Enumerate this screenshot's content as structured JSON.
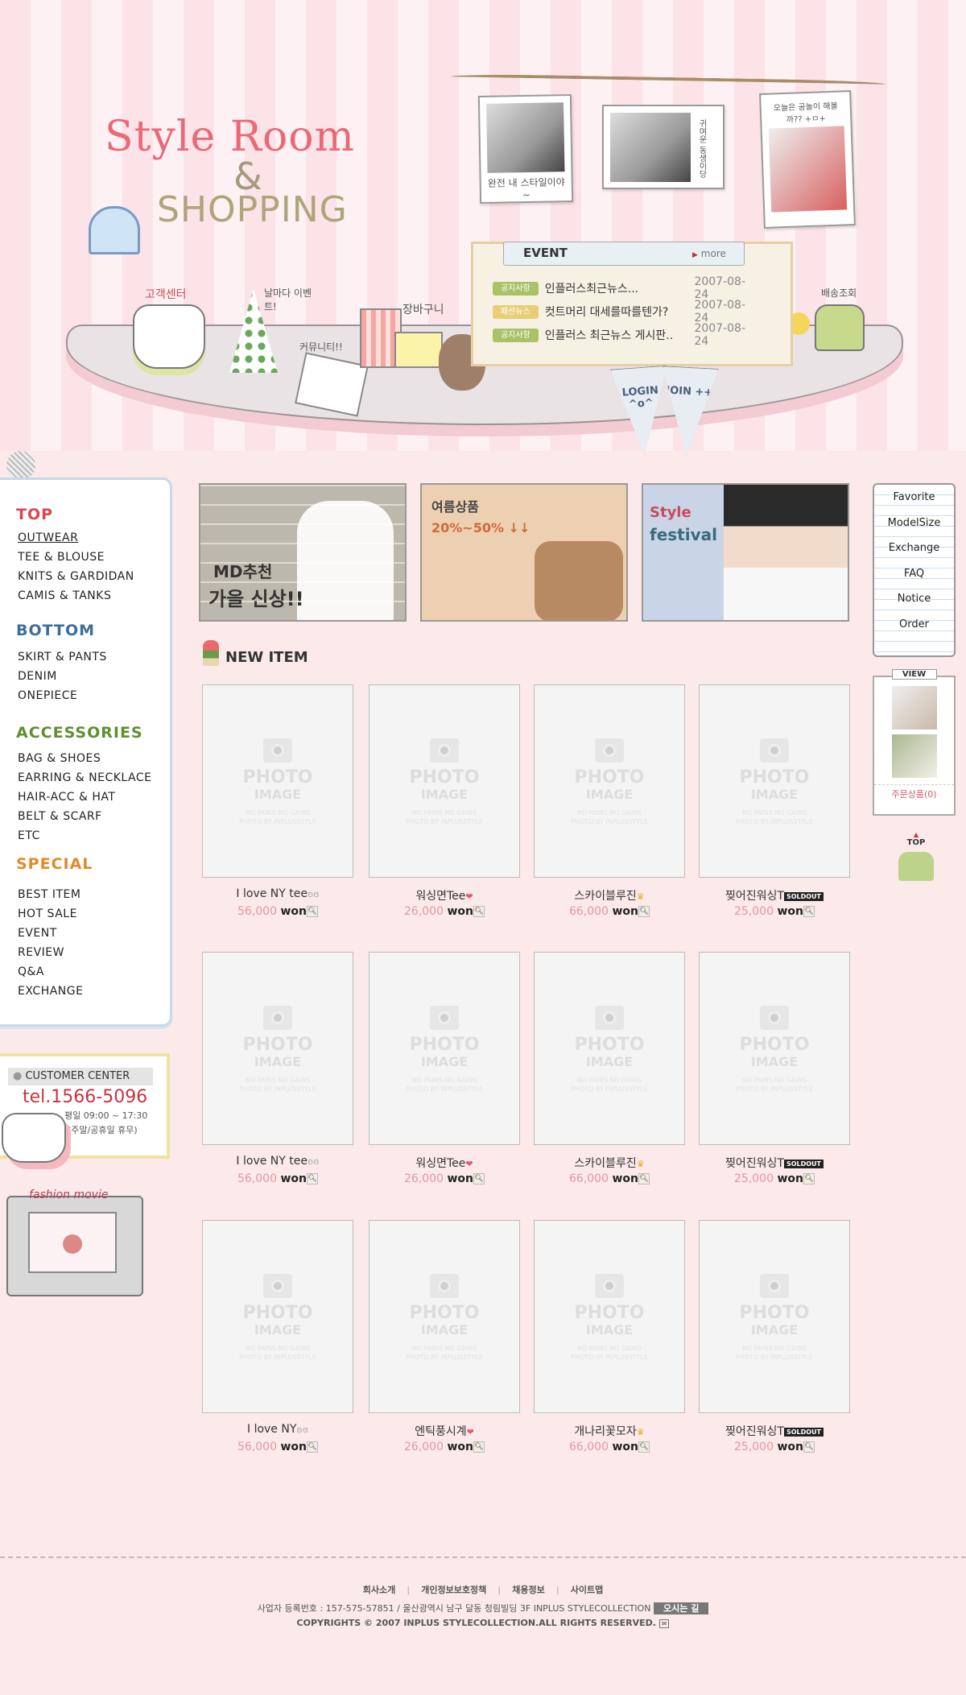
{
  "logo": {
    "line1": "Style Room",
    "amp": "&",
    "line2": "SHOPPING"
  },
  "hanging_photos": [
    {
      "caption": "완전 내 스타일이야~"
    },
    {
      "caption": "귀여운 동생이당"
    },
    {
      "caption": "오늘은 공놀이 해볼까?? +ㅁ+"
    }
  ],
  "shelf_links": {
    "customer_center": "고객센터",
    "event": "날마다 이벤트!",
    "community": "커뮤니티!!",
    "cart": "장바구니",
    "delivery": "배송조회"
  },
  "event_board": {
    "title": "EVENT",
    "more": "more",
    "rows": [
      {
        "tag": "공지사항",
        "tag_color": "#a9c267",
        "text": "인플러스최근뉴스...",
        "date": "2007-08-24"
      },
      {
        "tag": "패션뉴스",
        "tag_color": "#e8cf77",
        "text": "컷트머리 대세를따를텐가?",
        "date": "2007-08-24"
      },
      {
        "tag": "공지사항",
        "tag_color": "#a9c267",
        "text": "인플러스 최근뉴스 게시판..",
        "date": "2007-08-24"
      }
    ]
  },
  "flags": {
    "login": "LOGIN ^o^",
    "join": "JOIN ++"
  },
  "sidebar": {
    "sections": [
      {
        "title": "TOP",
        "color": "#d9474f",
        "items": [
          "OUTWEAR",
          "TEE & BLOUSE",
          "KNITS & GARDIDAN",
          "CAMIS & TANKS"
        ]
      },
      {
        "title": "BOTTOM",
        "color": "#3c6e9a",
        "items": [
          "SKIRT & PANTS",
          "DENIM",
          "ONEPIECE"
        ]
      },
      {
        "title": "ACCESSORIES",
        "color": "#5f8f2e",
        "items": [
          "BAG & SHOES",
          "EARRING & NECKLACE",
          "HAIR-ACC & HAT",
          "BELT & SCARF",
          "ETC"
        ]
      },
      {
        "title": "SPECIAL",
        "color": "#e08a2a",
        "items": [
          "BEST ITEM",
          "HOT SALE",
          "EVENT",
          "REVIEW",
          "Q&A",
          "EXCHANGE"
        ]
      }
    ]
  },
  "customer_center": {
    "title": "CUSTOMER CENTER",
    "tel": "tel.1566-5096",
    "hours": "평일 09:00 ~ 17:30",
    "closed": "(주말/공휴일 휴무)"
  },
  "fashion_movie": {
    "title": "fashion movie"
  },
  "banners": [
    {
      "text1": "MD추천",
      "text2": "가을 신상!!"
    },
    {
      "text1": "여름상품",
      "text2": "20%~50% ↓↓"
    },
    {
      "text1": "Style",
      "text2": "festival"
    }
  ],
  "new_item": {
    "title": "NEW ITEM"
  },
  "placeholder": {
    "line1": "PHOTO",
    "line2": "IMAGE",
    "line3": "NO PAINS NO GAINS",
    "line4": "PHOTO BY INPLUSSTYLE"
  },
  "currency": "won",
  "products": [
    {
      "name": "I love NY tee",
      "badge": "wings",
      "price": "56,000"
    },
    {
      "name": "워싱면Tee",
      "badge": "hearts",
      "price": "26,000"
    },
    {
      "name": "스카이블루진",
      "badge": "crown",
      "price": "66,000"
    },
    {
      "name": "찢어진워싱T",
      "badge": "SOLDOUT",
      "price": "25,000"
    },
    {
      "name": "I love NY tee",
      "badge": "wings",
      "price": "56,000"
    },
    {
      "name": "워싱면Tee",
      "badge": "hearts",
      "price": "26,000"
    },
    {
      "name": "스카이블루진",
      "badge": "crown",
      "price": "66,000"
    },
    {
      "name": "찢어진워싱T",
      "badge": "SOLDOUT",
      "price": "25,000"
    },
    {
      "name": "I love NY",
      "badge": "wings",
      "price": "56,000"
    },
    {
      "name": "엔틱풍시계",
      "badge": "hearts",
      "price": "26,000"
    },
    {
      "name": "개나리꽃모자",
      "badge": "crown",
      "price": "66,000"
    },
    {
      "name": "찢어진워싱T",
      "badge": "SOLDOUT",
      "price": "25,000"
    }
  ],
  "right_menu": [
    "Favorite",
    "ModelSize",
    "Exchange",
    "FAQ",
    "Notice",
    "Order"
  ],
  "view_panel": {
    "title": "VIEW",
    "label": "주문상품(0)"
  },
  "top_button": "TOP",
  "footer": {
    "links": [
      "회사소개",
      "개인정보보호정책",
      "채용정보",
      "사이트맵"
    ],
    "info": "사업자 등록번호 : 157-575-57851 / 울산광역시 남구 달동 청림빌딩 3F INPLUS STYLECOLLECTION",
    "directions": "오시는 길",
    "copyright": "COPYRIGHTS © 2007 INPLUS STYLECOLLECTION.ALL RIGHTS RESERVED."
  }
}
